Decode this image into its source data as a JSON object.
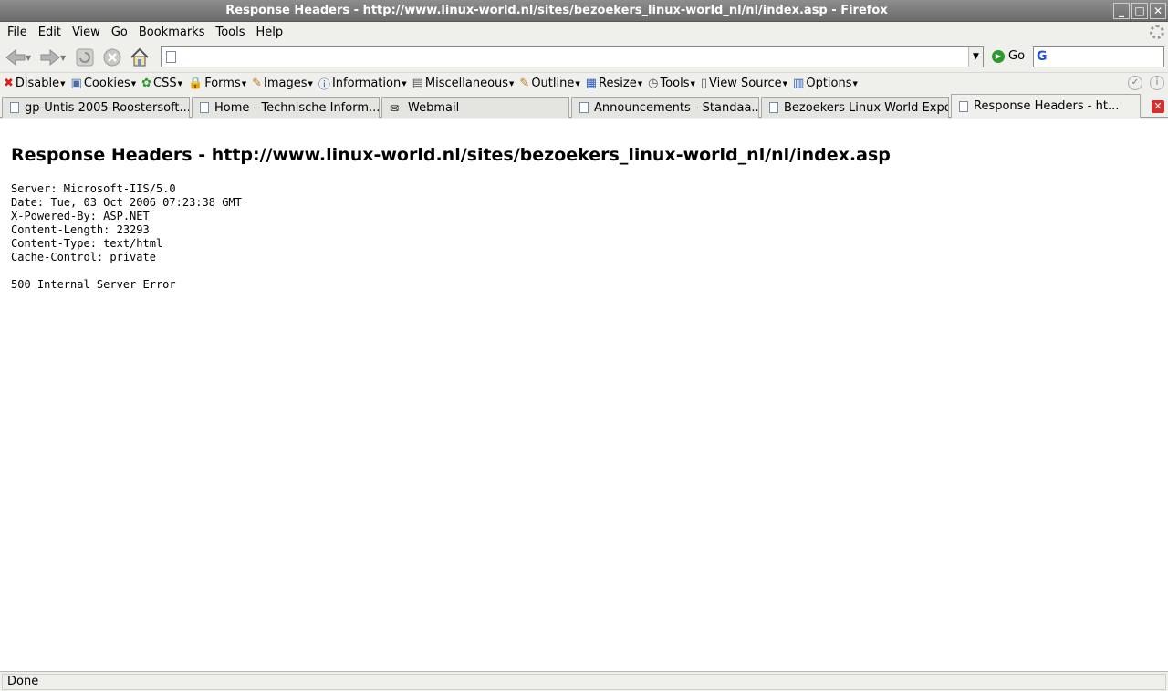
{
  "window": {
    "title": "Response Headers - http://www.linux-world.nl/sites/bezoekers_linux-world_nl/nl/index.asp - Firefox",
    "buttons": [
      "_",
      "□",
      "✕"
    ]
  },
  "menubar": {
    "items": [
      {
        "label": "File"
      },
      {
        "label": "Edit"
      },
      {
        "label": "View"
      },
      {
        "label": "Go"
      },
      {
        "label": "Bookmarks"
      },
      {
        "label": "Tools"
      },
      {
        "label": "Help"
      }
    ]
  },
  "navbar": {
    "url_value": "",
    "go_label": "Go",
    "search_value": ""
  },
  "devbar": {
    "items": [
      {
        "label": "Disable",
        "icon": "✖"
      },
      {
        "label": "Cookies",
        "icon": "▣"
      },
      {
        "label": "CSS",
        "icon": "✿"
      },
      {
        "label": "Forms",
        "icon": "🔒"
      },
      {
        "label": "Images",
        "icon": "✎"
      },
      {
        "label": "Information",
        "icon": "ⓘ"
      },
      {
        "label": "Miscellaneous",
        "icon": "▤"
      },
      {
        "label": "Outline",
        "icon": "✎"
      },
      {
        "label": "Resize",
        "icon": "▦"
      },
      {
        "label": "Tools",
        "icon": "◷"
      },
      {
        "label": "View Source",
        "icon": "▯"
      },
      {
        "label": "Options",
        "icon": "▥"
      }
    ]
  },
  "tabs": [
    {
      "label": "gp-Untis 2005 Roostersoft..."
    },
    {
      "label": "Home - Technische Inform..."
    },
    {
      "label": "Webmail"
    },
    {
      "label": "Announcements - Standaa..."
    },
    {
      "label": "Bezoekers Linux World Expo"
    },
    {
      "label": "Response Headers - ht..."
    }
  ],
  "content": {
    "heading": "Response Headers - http://www.linux-world.nl/sites/bezoekers_linux-world_nl/nl/index.asp",
    "headers": [
      "Server: Microsoft-IIS/5.0",
      "Date: Tue, 03 Oct 2006 07:23:38 GMT",
      "X-Powered-By: ASP.NET",
      "Content-Length: 23293",
      "Content-Type: text/html",
      "Cache-Control: private",
      "",
      "500 Internal Server Error"
    ]
  },
  "status": {
    "text": "Done"
  }
}
